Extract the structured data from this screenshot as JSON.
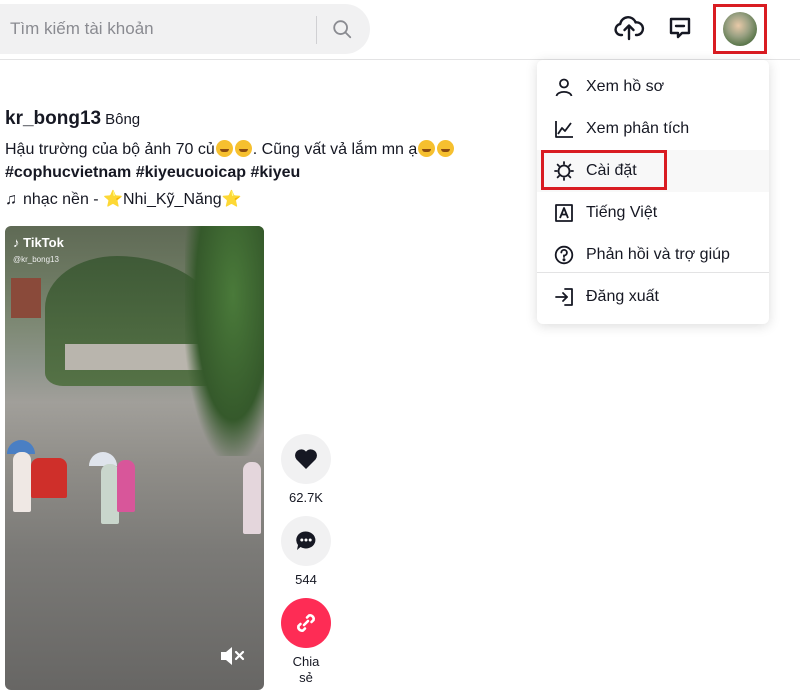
{
  "header": {
    "search_placeholder": "Tìm kiếm tài khoản",
    "icons": {
      "search": "search-icon",
      "upload": "cloud-upload-icon",
      "inbox": "message-icon"
    }
  },
  "menu": {
    "items": [
      {
        "label": "Xem hồ sơ",
        "icon": "user-icon"
      },
      {
        "label": "Xem phân tích",
        "icon": "analytics-icon"
      },
      {
        "label": "Cài đặt",
        "icon": "settings-icon"
      },
      {
        "label": "Tiếng Việt",
        "icon": "language-icon"
      },
      {
        "label": "Phản hồi và trợ giúp",
        "icon": "help-icon"
      },
      {
        "label": "Đăng xuất",
        "icon": "logout-icon"
      }
    ]
  },
  "post": {
    "username": "kr_bong13",
    "nickname": "Bông",
    "caption_part1": "Hậu trường của bộ ảnh 70 củ",
    "caption_part2": ". Cũng vất vả lắm mn ạ",
    "hashtags": [
      "#cophucvietnam",
      "#kiyeucuoicap",
      "#kiyeu"
    ],
    "music": "nhạc nền - ⭐Nhi_Kỹ_Năng⭐",
    "video": {
      "logo_text": "TikTok",
      "handle": "@kr_bong13"
    },
    "likes": "62.7K",
    "comments": "544",
    "share_label_line1": "Chia",
    "share_label_line2": "sẻ"
  },
  "colors": {
    "accent": "#fe2c55",
    "highlight": "#d91c22"
  }
}
